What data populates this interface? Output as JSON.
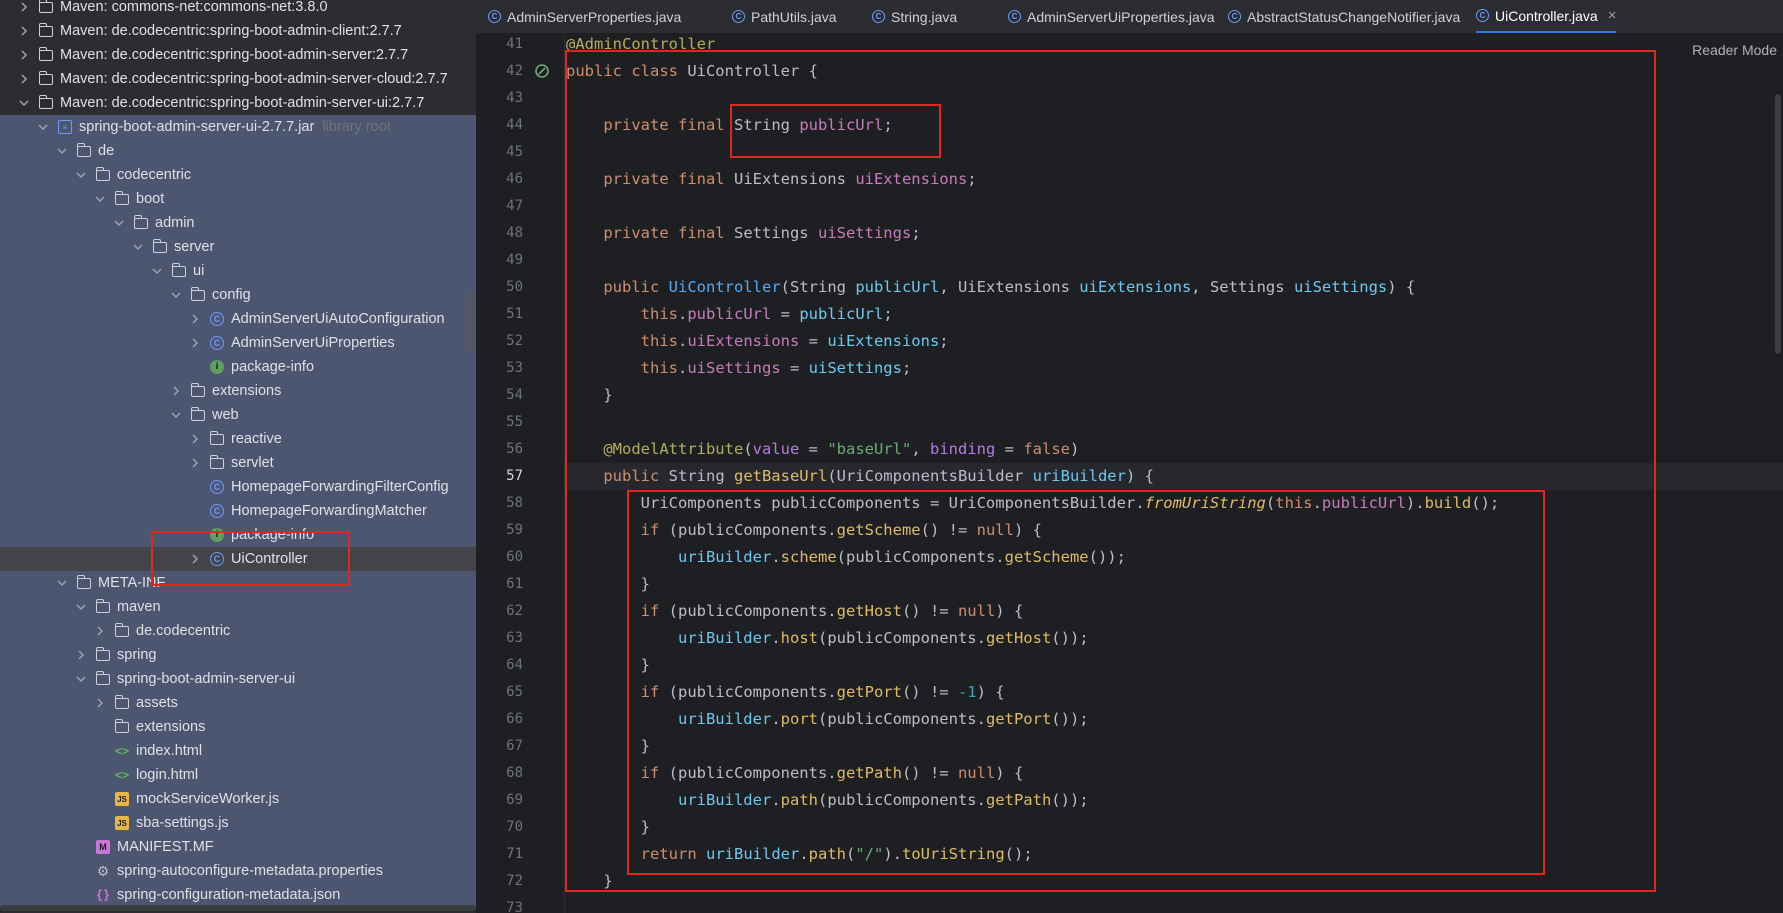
{
  "project_tree": [
    {
      "indent": 1,
      "arrow": "right",
      "icon": "maven",
      "label": "Maven: commons-net:commons-net:3.8.0"
    },
    {
      "indent": 1,
      "arrow": "right",
      "icon": "maven",
      "label": "Maven: de.codecentric:spring-boot-admin-client:2.7.7"
    },
    {
      "indent": 1,
      "arrow": "right",
      "icon": "maven",
      "label": "Maven: de.codecentric:spring-boot-admin-server:2.7.7"
    },
    {
      "indent": 1,
      "arrow": "right",
      "icon": "maven",
      "label": "Maven: de.codecentric:spring-boot-admin-server-cloud:2.7.7"
    },
    {
      "indent": 1,
      "arrow": "down",
      "icon": "maven",
      "label": "Maven: de.codecentric:spring-boot-admin-server-ui:2.7.7"
    },
    {
      "indent": 2,
      "arrow": "down",
      "icon": "jar",
      "label": "spring-boot-admin-server-ui-2.7.7.jar",
      "hint": "library root",
      "blue": true
    },
    {
      "indent": 3,
      "arrow": "down",
      "icon": "folder",
      "label": "de",
      "blue": true
    },
    {
      "indent": 4,
      "arrow": "down",
      "icon": "folder",
      "label": "codecentric",
      "blue": true
    },
    {
      "indent": 5,
      "arrow": "down",
      "icon": "folder",
      "label": "boot",
      "blue": true
    },
    {
      "indent": 6,
      "arrow": "down",
      "icon": "folder",
      "label": "admin",
      "blue": true
    },
    {
      "indent": 7,
      "arrow": "down",
      "icon": "folder",
      "label": "server",
      "blue": true
    },
    {
      "indent": 8,
      "arrow": "down",
      "icon": "folder",
      "label": "ui",
      "blue": true
    },
    {
      "indent": 9,
      "arrow": "down",
      "icon": "folder",
      "label": "config",
      "blue": true
    },
    {
      "indent": 10,
      "arrow": "right",
      "icon": "class",
      "label": "AdminServerUiAutoConfiguration",
      "blue": true
    },
    {
      "indent": 10,
      "arrow": "right",
      "icon": "class",
      "label": "AdminServerUiProperties",
      "blue": true
    },
    {
      "indent": 10,
      "arrow": "none",
      "icon": "info",
      "label": "package-info",
      "blue": true
    },
    {
      "indent": 9,
      "arrow": "right",
      "icon": "folder",
      "label": "extensions",
      "blue": true
    },
    {
      "indent": 9,
      "arrow": "down",
      "icon": "folder",
      "label": "web",
      "blue": true
    },
    {
      "indent": 10,
      "arrow": "right",
      "icon": "folder",
      "label": "reactive",
      "blue": true
    },
    {
      "indent": 10,
      "arrow": "right",
      "icon": "folder",
      "label": "servlet",
      "blue": true
    },
    {
      "indent": 10,
      "arrow": "none",
      "icon": "class",
      "label": "HomepageForwardingFilterConfig",
      "blue": true
    },
    {
      "indent": 10,
      "arrow": "none",
      "icon": "class",
      "label": "HomepageForwardingMatcher",
      "blue": true
    },
    {
      "indent": 10,
      "arrow": "none",
      "icon": "info",
      "label": "package-info",
      "blue": true
    },
    {
      "indent": 10,
      "arrow": "right",
      "icon": "class",
      "label": "UiController",
      "selected": true
    },
    {
      "indent": 3,
      "arrow": "down",
      "icon": "folder",
      "label": "META-INF",
      "blue": true
    },
    {
      "indent": 4,
      "arrow": "down",
      "icon": "folder",
      "label": "maven",
      "blue": true
    },
    {
      "indent": 5,
      "arrow": "right",
      "icon": "folder",
      "label": "de.codecentric",
      "blue": true
    },
    {
      "indent": 4,
      "arrow": "right",
      "icon": "folder",
      "label": "spring",
      "blue": true
    },
    {
      "indent": 4,
      "arrow": "down",
      "icon": "folder",
      "label": "spring-boot-admin-server-ui",
      "blue": true
    },
    {
      "indent": 5,
      "arrow": "right",
      "icon": "folder",
      "label": "assets",
      "blue": true
    },
    {
      "indent": 5,
      "arrow": "none",
      "icon": "folder",
      "label": "extensions",
      "blue": true
    },
    {
      "indent": 5,
      "arrow": "none",
      "icon": "html",
      "label": "index.html",
      "blue": true
    },
    {
      "indent": 5,
      "arrow": "none",
      "icon": "html",
      "label": "login.html",
      "blue": true
    },
    {
      "indent": 5,
      "arrow": "none",
      "icon": "js",
      "label": "mockServiceWorker.js",
      "blue": true
    },
    {
      "indent": 5,
      "arrow": "none",
      "icon": "js",
      "label": "sba-settings.js",
      "blue": true
    },
    {
      "indent": 4,
      "arrow": "none",
      "icon": "mf",
      "label": "MANIFEST.MF",
      "blue": true
    },
    {
      "indent": 4,
      "arrow": "none",
      "icon": "gear",
      "label": "spring-autoconfigure-metadata.properties",
      "blue": true
    },
    {
      "indent": 4,
      "arrow": "none",
      "icon": "json",
      "label": "spring-configuration-metadata.json",
      "blue": true
    }
  ],
  "tabs": [
    {
      "label": "AdminServerProperties.java"
    },
    {
      "label": "PathUtils.java"
    },
    {
      "label": "String.java"
    },
    {
      "label": "AdminServerUiProperties.java"
    },
    {
      "label": "AbstractStatusChangeNotifier.java"
    },
    {
      "label": "UiController.java",
      "active": true
    }
  ],
  "editor": {
    "reader_mode": "Reader Mode",
    "current_line": "57",
    "lines": [
      {
        "n": "41",
        "html": "<span class=\"ann\">@AdminController</span>"
      },
      {
        "n": "42",
        "html": "<span class=\"kw\">public class</span> UiController {"
      },
      {
        "n": "43",
        "html": ""
      },
      {
        "n": "44",
        "html": "    <span class=\"kw\">private final</span> String <span class=\"fld\">publicUrl</span>;"
      },
      {
        "n": "45",
        "html": ""
      },
      {
        "n": "46",
        "html": "    <span class=\"kw\">private final</span> UiExtensions <span class=\"fld\">uiExtensions</span>;"
      },
      {
        "n": "47",
        "html": ""
      },
      {
        "n": "48",
        "html": "    <span class=\"kw\">private final</span> Settings <span class=\"fld\">uiSettings</span>;"
      },
      {
        "n": "49",
        "html": ""
      },
      {
        "n": "50",
        "html": "    <span class=\"kw\">public</span> <span class=\"mth\">UiController</span>(String <span class=\"par\">publicUrl</span>, UiExtensions <span class=\"par\">uiExtensions</span>, Settings <span class=\"par\">uiSettings</span>) {"
      },
      {
        "n": "51",
        "html": "        <span class=\"kw\">this</span>.<span class=\"fld\">publicUrl</span> = <span class=\"par\">publicUrl</span>;"
      },
      {
        "n": "52",
        "html": "        <span class=\"kw\">this</span>.<span class=\"fld\">uiExtensions</span> = <span class=\"par\">uiExtensions</span>;"
      },
      {
        "n": "53",
        "html": "        <span class=\"kw\">this</span>.<span class=\"fld\">uiSettings</span> = <span class=\"par\">uiSettings</span>;"
      },
      {
        "n": "54",
        "html": "    }"
      },
      {
        "n": "55",
        "html": ""
      },
      {
        "n": "56",
        "html": "    <span class=\"ann\">@ModelAttribute</span>(<span class=\"kwb\">value</span> = <span class=\"str\">\"baseUrl\"</span>, <span class=\"kwb\">binding</span> = <span class=\"kw\">false</span>)"
      },
      {
        "n": "57",
        "html": "    <span class=\"kw\">public</span> String <span class=\"call\">getBaseUrl</span>(UriComponentsBuilder <span class=\"par\">uriBuilder</span>) {"
      },
      {
        "n": "58",
        "html": "        UriComponents publicComponents = UriComponentsBuilder.<span class=\"ital\">fromUriString</span>(<span class=\"kw\">this</span>.<span class=\"fld\">publicUrl</span>).<span class=\"call\">build</span>();"
      },
      {
        "n": "59",
        "html": "        <span class=\"kw\">if</span> (publicComponents.<span class=\"call\">getScheme</span>() != <span class=\"kw\">null</span>) {"
      },
      {
        "n": "60",
        "html": "            <span class=\"par\">uriBuilder</span>.<span class=\"call\">scheme</span>(publicComponents.<span class=\"call\">getScheme</span>());"
      },
      {
        "n": "61",
        "html": "        }"
      },
      {
        "n": "62",
        "html": "        <span class=\"kw\">if</span> (publicComponents.<span class=\"call\">getHost</span>() != <span class=\"kw\">null</span>) {"
      },
      {
        "n": "63",
        "html": "            <span class=\"par\">uriBuilder</span>.<span class=\"call\">host</span>(publicComponents.<span class=\"call\">getHost</span>());"
      },
      {
        "n": "64",
        "html": "        }"
      },
      {
        "n": "65",
        "html": "        <span class=\"kw\">if</span> (publicComponents.<span class=\"call\">getPort</span>() != <span class=\"num\">-1</span>) {"
      },
      {
        "n": "66",
        "html": "            <span class=\"par\">uriBuilder</span>.<span class=\"call\">port</span>(publicComponents.<span class=\"call\">getPort</span>());"
      },
      {
        "n": "67",
        "html": "        }"
      },
      {
        "n": "68",
        "html": "        <span class=\"kw\">if</span> (publicComponents.<span class=\"call\">getPath</span>() != <span class=\"kw\">null</span>) {"
      },
      {
        "n": "69",
        "html": "            <span class=\"par\">uriBuilder</span>.<span class=\"call\">path</span>(publicComponents.<span class=\"call\">getPath</span>());"
      },
      {
        "n": "70",
        "html": "        }"
      },
      {
        "n": "71",
        "html": "        <span class=\"kw\">return</span> <span class=\"par\">uriBuilder</span>.<span class=\"call\">path</span>(<span class=\"str\">\"/\"</span>).<span class=\"call\">toUriString</span>();"
      },
      {
        "n": "72",
        "html": "    }"
      },
      {
        "n": "73",
        "html": ""
      }
    ]
  }
}
